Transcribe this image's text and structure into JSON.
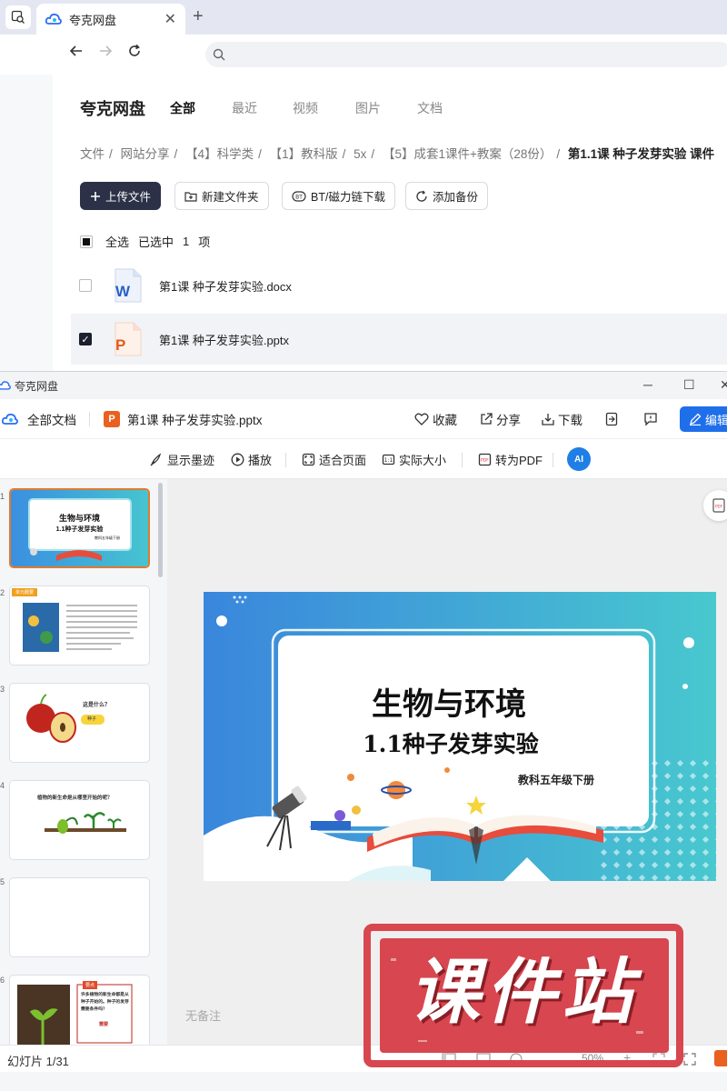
{
  "browser": {
    "tab_title": "夸克网盘",
    "tab_close": "✕",
    "new_tab": "+"
  },
  "drive": {
    "logo": "夸克网盘",
    "categories": [
      "全部",
      "最近",
      "视频",
      "图片",
      "文档"
    ],
    "breadcrumb": [
      "文件",
      "网站分享",
      "【4】科学类",
      "【1】教科版",
      "5x",
      "【5】成套1课件+教案（28份）"
    ],
    "breadcrumb_current": "第1.1课 种子发芽实验 课件",
    "breadcrumb_sep": "/",
    "toolbar": {
      "upload": "上传文件",
      "new_folder": "新建文件夹",
      "bt_download": "BT/磁力链下载",
      "add_backup": "添加备份"
    },
    "selection": {
      "select_all": "全选",
      "selected": "已选中",
      "count": "1",
      "unit": "项"
    },
    "files": [
      {
        "name": "第1课 种子发芽实验.docx",
        "type": "docx",
        "icon_letter": "W",
        "checked": false
      },
      {
        "name": "第1课 种子发芽实验.pptx",
        "type": "pptx",
        "icon_letter": "P",
        "checked": true
      }
    ]
  },
  "viewer": {
    "window_title": "夸克网盘",
    "all_docs": "全部文档",
    "file_name": "第1课 种子发芽实验.pptx",
    "file_badge": "P",
    "actions": {
      "favorite": "收藏",
      "share": "分享",
      "download": "下载",
      "edit": "编辑"
    },
    "tools": {
      "show_ink": "显示墨迹",
      "play": "播放",
      "fit_page": "适合页面",
      "actual_size": "实际大小",
      "to_pdf": "转为PDF",
      "ai": "AI"
    },
    "slide": {
      "title": "生物与环境",
      "subtitle": "1.1种子发芽实验",
      "grade": "教科五年级下册"
    },
    "thumbs": [
      {
        "num": "1",
        "title": "生物与环境",
        "subtitle": "1.1种子发芽实验",
        "grade": "教科五年级下册"
      },
      {
        "num": "2",
        "tag": "单元概要"
      },
      {
        "num": "3",
        "q": "这是什么？",
        "a": "种子"
      },
      {
        "num": "4",
        "q": "植物的新生命是从哪里开始的呢？"
      },
      {
        "num": "5"
      },
      {
        "num": "6",
        "tag": "要点",
        "text": "许多植物的新生命都是从种子开始的。种子的发芽需要条件吗？",
        "ans": "需要"
      }
    ],
    "no_notes": "无备注",
    "status": "幻灯片 1/31",
    "zoom": "50%"
  },
  "watermark": {
    "text": "课件站"
  },
  "colors": {
    "primary_btn": "#2c3147",
    "edit_btn": "#1f6feb",
    "active_thumb": "#e07a2f",
    "watermark": "#d8464f"
  }
}
